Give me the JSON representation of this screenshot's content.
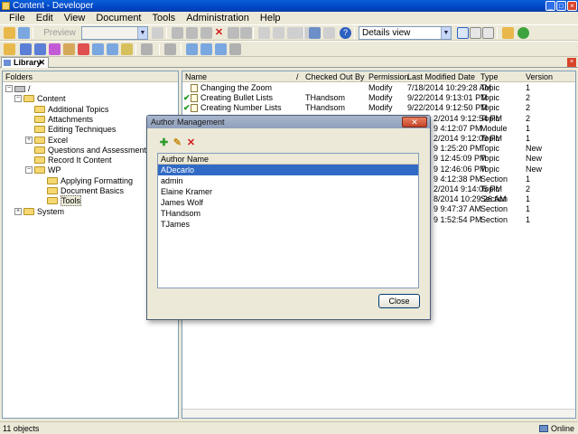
{
  "window": {
    "title": "Content - Developer"
  },
  "menu": [
    "File",
    "Edit",
    "View",
    "Document",
    "Tools",
    "Administration",
    "Help"
  ],
  "toolbar": {
    "preview_label": "Preview",
    "view_select": "Details view"
  },
  "library_tab": {
    "label": "Library",
    "close_glyph": "✕"
  },
  "folders": {
    "header": "Folders",
    "items": [
      {
        "label": "/",
        "level": 0,
        "expander": "−"
      },
      {
        "label": "Content",
        "level": 1,
        "expander": "−"
      },
      {
        "label": "Additional Topics",
        "level": 2,
        "expander": ""
      },
      {
        "label": "Attachments",
        "level": 2,
        "expander": ""
      },
      {
        "label": "Editing Techniques",
        "level": 2,
        "expander": ""
      },
      {
        "label": "Excel",
        "level": 2,
        "expander": "+"
      },
      {
        "label": "Questions and Assessments",
        "level": 2,
        "expander": ""
      },
      {
        "label": "Record It Content",
        "level": 2,
        "expander": ""
      },
      {
        "label": "WP",
        "level": 2,
        "expander": "−"
      },
      {
        "label": "Applying Formatting",
        "level": 3,
        "expander": ""
      },
      {
        "label": "Document Basics",
        "level": 3,
        "expander": ""
      },
      {
        "label": "Tools",
        "level": 3,
        "expander": ""
      },
      {
        "label": "System",
        "level": 1,
        "expander": "+"
      }
    ]
  },
  "grid": {
    "columns": [
      "Name",
      "/",
      "Checked Out By",
      "Permission",
      "Last Modified Date",
      "Type",
      "Version"
    ],
    "rows": [
      {
        "check": "",
        "name": "Changing the Zoom",
        "checked_out_by": "",
        "permission": "Modify",
        "modified": "7/18/2014 10:29:28 AM",
        "type": "Topic",
        "version": "1"
      },
      {
        "check": "✔",
        "name": "Creating Bullet Lists",
        "checked_out_by": "THandsom",
        "permission": "Modify",
        "modified": "9/22/2014 9:13:01 PM",
        "type": "Topic",
        "version": "2"
      },
      {
        "check": "✔",
        "name": "Creating Number Lists",
        "checked_out_by": "THandsom",
        "permission": "Modify",
        "modified": "9/22/2014 9:12:50 PM",
        "type": "Topic",
        "version": "2"
      },
      {
        "check": "",
        "name": "",
        "checked_out_by": "",
        "permission": "",
        "modified": "2/2014 9:12:54 PM",
        "type": "Topic",
        "version": "2"
      },
      {
        "check": "",
        "name": "",
        "checked_out_by": "",
        "permission": "",
        "modified": "9 4:12:07 PM",
        "type": "Module",
        "version": "1"
      },
      {
        "check": "",
        "name": "",
        "checked_out_by": "",
        "permission": "",
        "modified": "2/2014 9:12:09 PM",
        "type": "Topic",
        "version": "1"
      },
      {
        "check": "",
        "name": "",
        "checked_out_by": "",
        "permission": "",
        "modified": "9 1:25:20 PM",
        "type": "Topic",
        "version": "New"
      },
      {
        "check": "",
        "name": "",
        "checked_out_by": "",
        "permission": "",
        "modified": "9 12:45:09 PM",
        "type": "Topic",
        "version": "New"
      },
      {
        "check": "",
        "name": "",
        "checked_out_by": "",
        "permission": "",
        "modified": "9 12:46:06 PM",
        "type": "Topic",
        "version": "New"
      },
      {
        "check": "",
        "name": "",
        "checked_out_by": "",
        "permission": "",
        "modified": "9 4:12:38 PM",
        "type": "Section",
        "version": "1"
      },
      {
        "check": "",
        "name": "",
        "checked_out_by": "",
        "permission": "",
        "modified": "2/2014 9:14:05 PM",
        "type": "Topic",
        "version": "2"
      },
      {
        "check": "",
        "name": "",
        "checked_out_by": "",
        "permission": "",
        "modified": "8/2014 10:29:26 AM",
        "type": "Section",
        "version": "1"
      },
      {
        "check": "",
        "name": "",
        "checked_out_by": "",
        "permission": "",
        "modified": "9 9:47:37 AM",
        "type": "Section",
        "version": "1"
      },
      {
        "check": "",
        "name": "",
        "checked_out_by": "",
        "permission": "",
        "modified": "9 1:52:54 PM",
        "type": "Section",
        "version": "1"
      }
    ]
  },
  "status": {
    "count": "11 objects",
    "online": "Online"
  },
  "dialog": {
    "title": "Author Management",
    "close_glyph": "✕",
    "column": "Author Name",
    "authors": [
      "ADecarlo",
      "admin",
      "Elaine Kramer",
      "James Wolf",
      "THandsom",
      "TJames"
    ],
    "selected_index": 0,
    "close_label": "Close"
  }
}
